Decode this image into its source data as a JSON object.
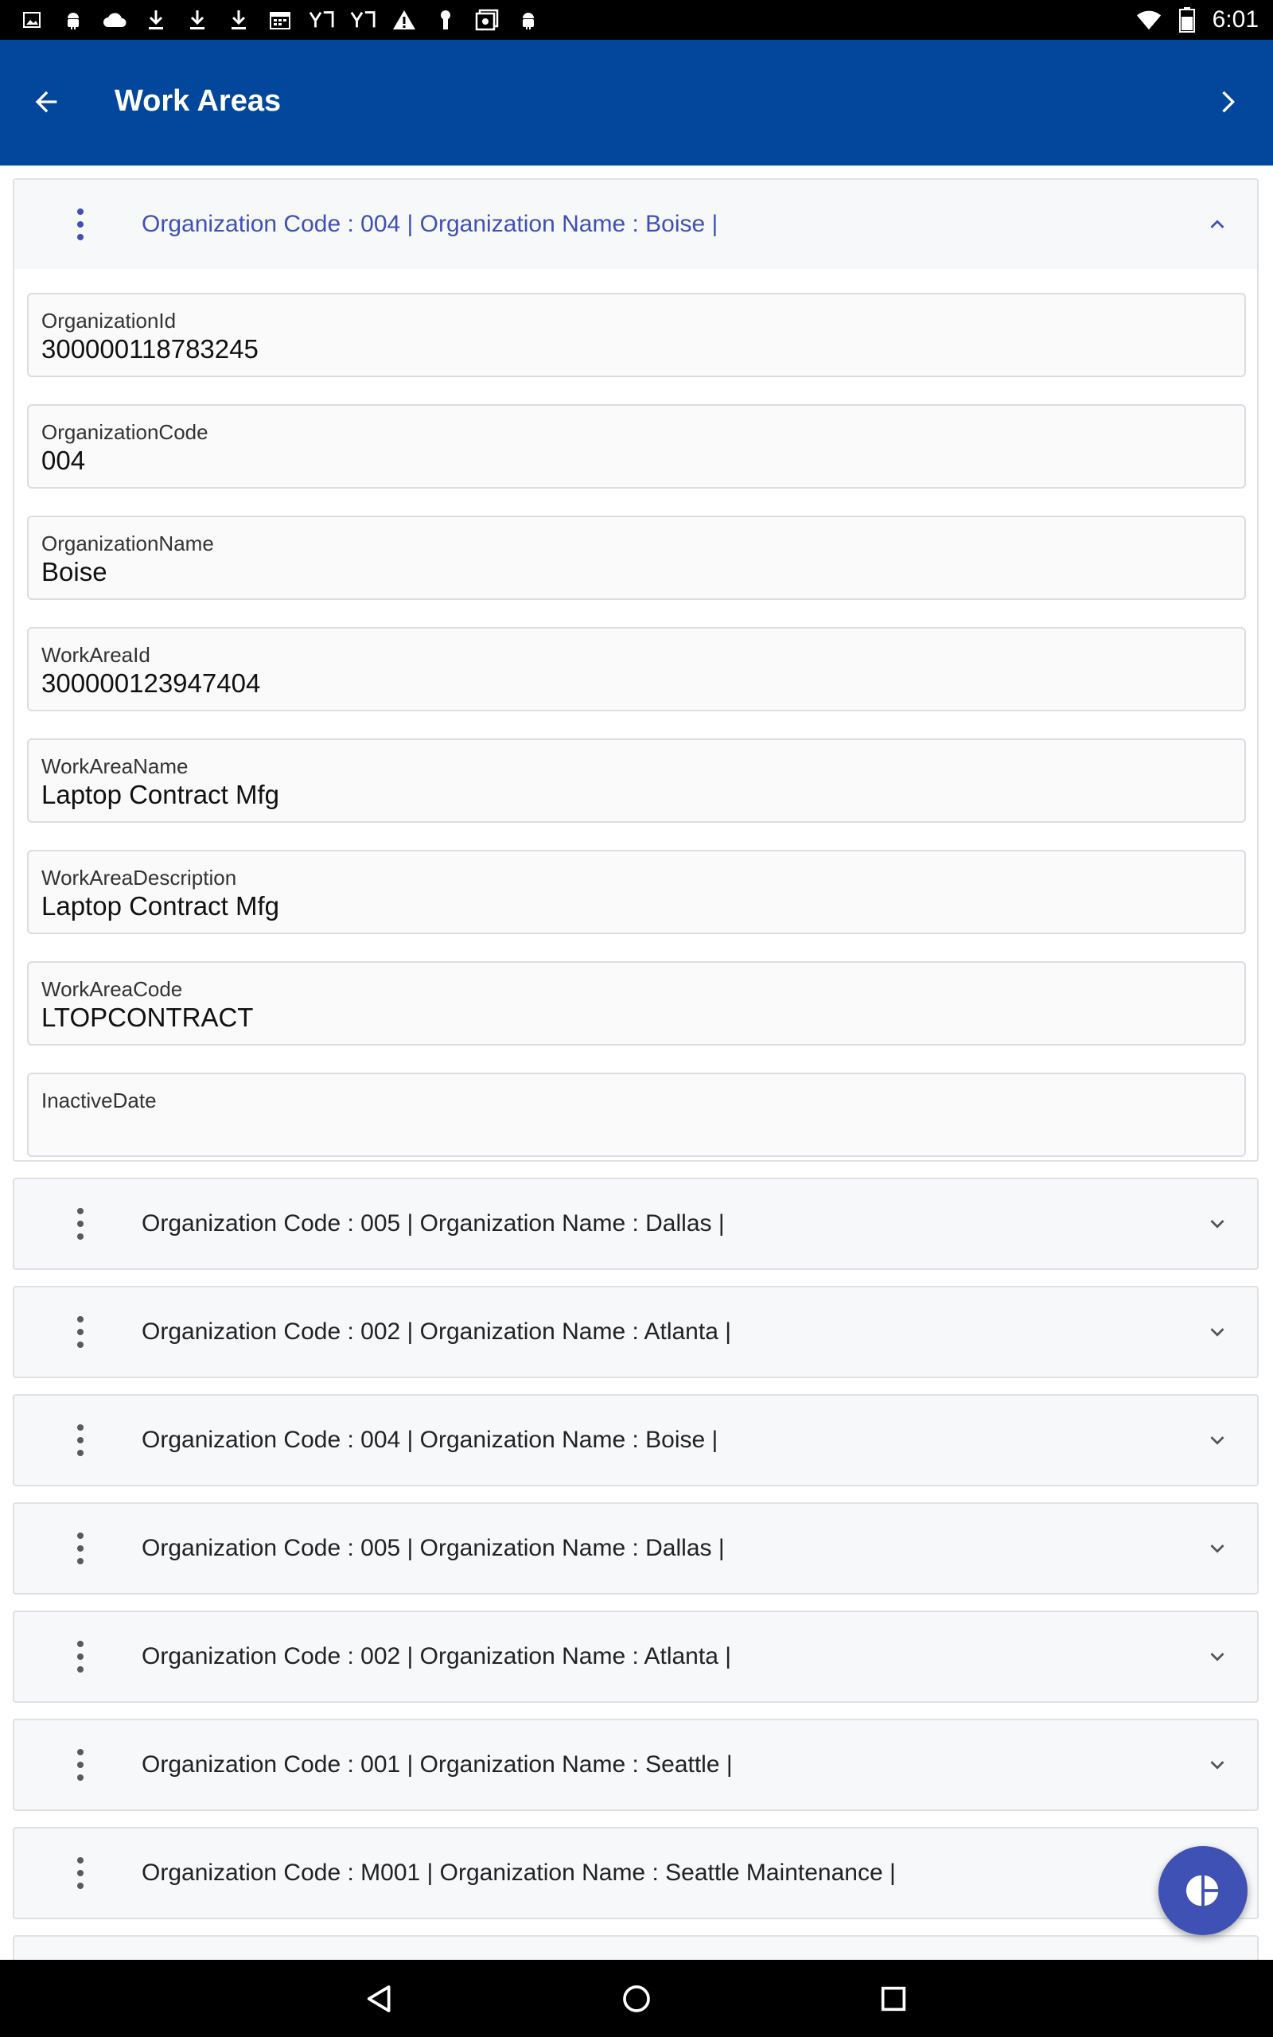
{
  "status_bar": {
    "time": "6:01",
    "notification_icons": [
      "image-icon",
      "android-icon",
      "cloud-icon",
      "download-icon",
      "download-icon",
      "download-icon",
      "calendar-icon",
      "yahoo-icon",
      "yahoo-icon",
      "warning-icon",
      "key-icon",
      "photo-icon",
      "android-icon"
    ],
    "system_icons": [
      "wifi-icon",
      "battery-icon"
    ]
  },
  "app_bar": {
    "title": "Work Areas",
    "back_icon": "arrow-left-icon",
    "next_icon": "chevron-right-icon",
    "color": "#02479b"
  },
  "expanded_record": {
    "header": "Organization Code : 004 | Organization Name : Boise |",
    "fields": [
      {
        "label": "OrganizationId",
        "value": "300000118783245"
      },
      {
        "label": "OrganizationCode",
        "value": "004"
      },
      {
        "label": "OrganizationName",
        "value": "Boise"
      },
      {
        "label": "WorkAreaId",
        "value": "300000123947404"
      },
      {
        "label": "WorkAreaName",
        "value": "Laptop Contract Mfg"
      },
      {
        "label": "WorkAreaDescription",
        "value": "Laptop Contract Mfg"
      },
      {
        "label": "WorkAreaCode",
        "value": "LTOPCONTRACT"
      },
      {
        "label": "InactiveDate",
        "value": ""
      }
    ]
  },
  "records": [
    {
      "header": "Organization Code : 005 | Organization Name : Dallas |"
    },
    {
      "header": "Organization Code : 002 | Organization Name : Atlanta |"
    },
    {
      "header": "Organization Code : 004 | Organization Name : Boise |"
    },
    {
      "header": "Organization Code : 005 | Organization Name : Dallas |"
    },
    {
      "header": "Organization Code : 002 | Organization Name : Atlanta |"
    },
    {
      "header": "Organization Code : 001 | Organization Name : Seattle |"
    },
    {
      "header": "Organization Code : M001 | Organization Name : Seattle Maintenance |"
    }
  ],
  "fab": {
    "icon": "pie-chart-icon",
    "color": "#3f51b5"
  },
  "accent_color": "#3f51b5"
}
